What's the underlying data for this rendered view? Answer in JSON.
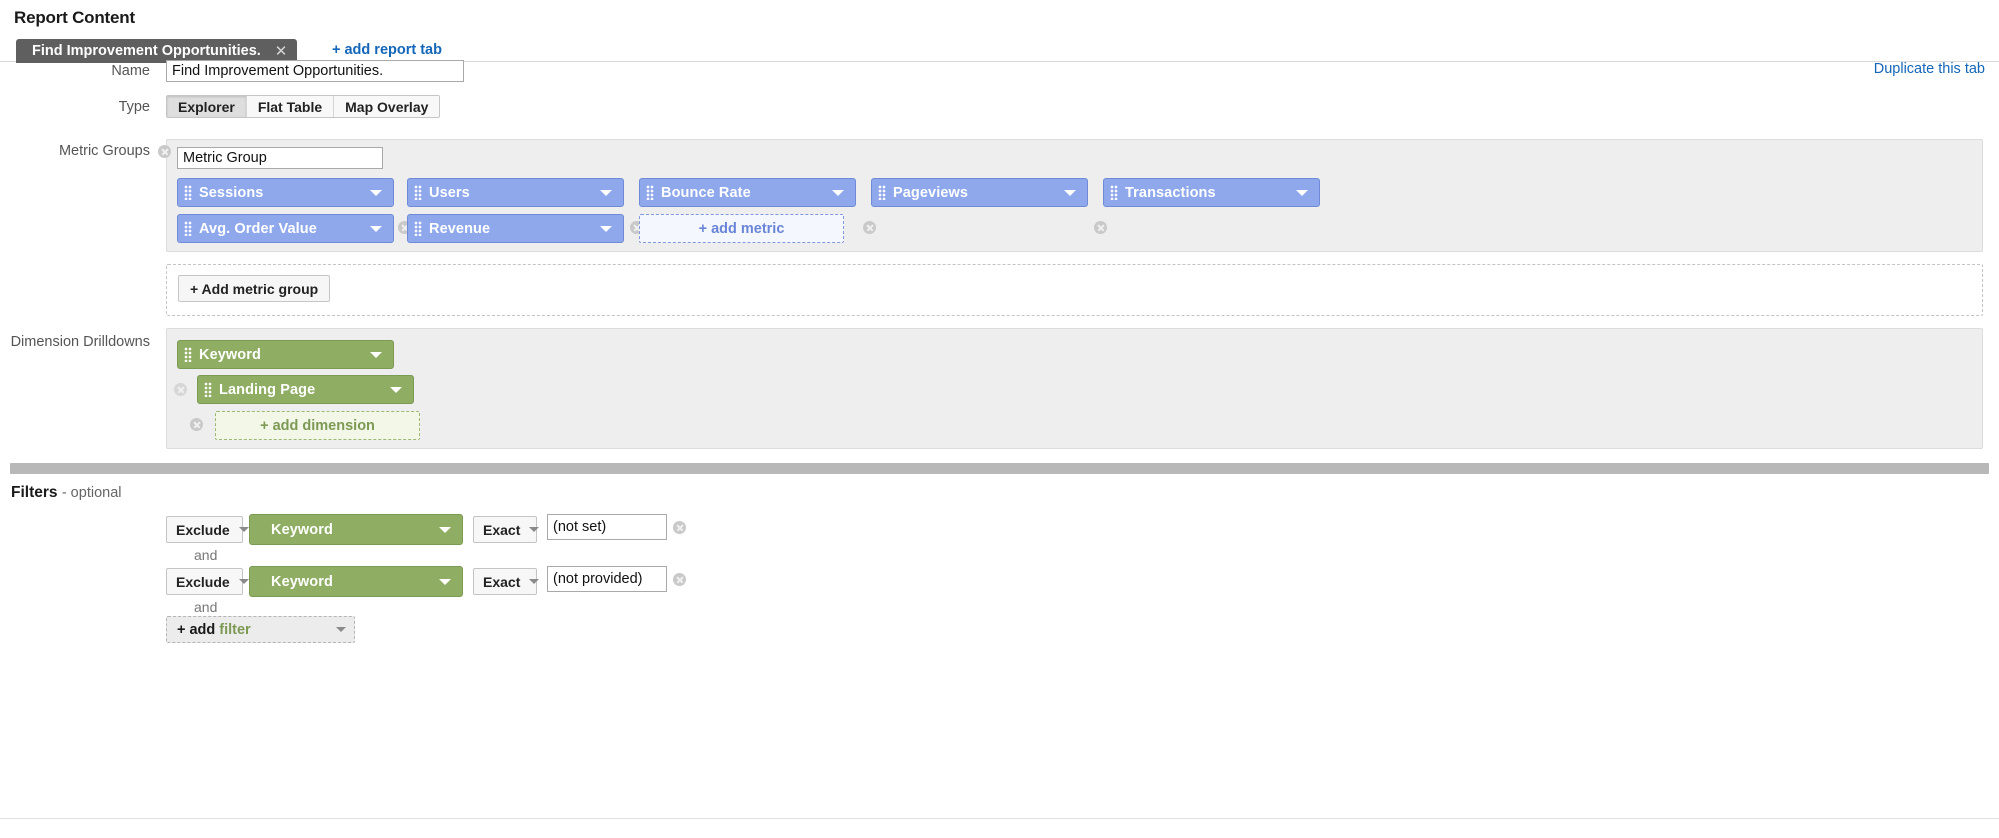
{
  "header": {
    "title": "Report Content",
    "add_report_tab": "+ add report tab",
    "duplicate_tab": "Duplicate this tab",
    "tab": {
      "label": "Find Improvement Opportunities.",
      "close_icon": "close-icon"
    }
  },
  "name_row": {
    "label": "Name",
    "value": "Find Improvement Opportunities."
  },
  "type_row": {
    "label": "Type",
    "options": [
      {
        "label": "Explorer",
        "selected": true
      },
      {
        "label": "Flat Table",
        "selected": false
      },
      {
        "label": "Map Overlay",
        "selected": false
      }
    ]
  },
  "metric_groups": {
    "label": "Metric Groups",
    "group_name": "Metric Group",
    "row1": [
      {
        "label": "Sessions"
      },
      {
        "label": "Users"
      },
      {
        "label": "Bounce Rate"
      },
      {
        "label": "Pageviews"
      },
      {
        "label": "Transactions"
      }
    ],
    "row2": [
      {
        "label": "Avg. Order Value"
      },
      {
        "label": "Revenue"
      }
    ],
    "add_metric": "+ add metric",
    "add_metric_group": "+ Add metric group"
  },
  "dimension_drilldowns": {
    "label": "Dimension Drilldowns",
    "items": [
      {
        "label": "Keyword"
      },
      {
        "label": "Landing Page"
      }
    ],
    "add_dimension": "+ add dimension"
  },
  "filters": {
    "title": "Filters",
    "subtitle": "- optional",
    "rows": [
      {
        "mode": "Exclude",
        "dimension": "Keyword",
        "match": "Exact",
        "value": "(not set)",
        "conjunction": "and"
      },
      {
        "mode": "Exclude",
        "dimension": "Keyword",
        "match": "Exact",
        "value": "(not provided)",
        "conjunction": "and"
      }
    ],
    "add_filter_prefix": "+ add",
    "add_filter_word": "filter"
  },
  "colors": {
    "metric_pill": "#8fa8ec",
    "dimension_pill": "#8fad63",
    "link": "#1466b8",
    "tab_bg": "#5f5f5f",
    "panel_bg": "#eeeeee"
  }
}
